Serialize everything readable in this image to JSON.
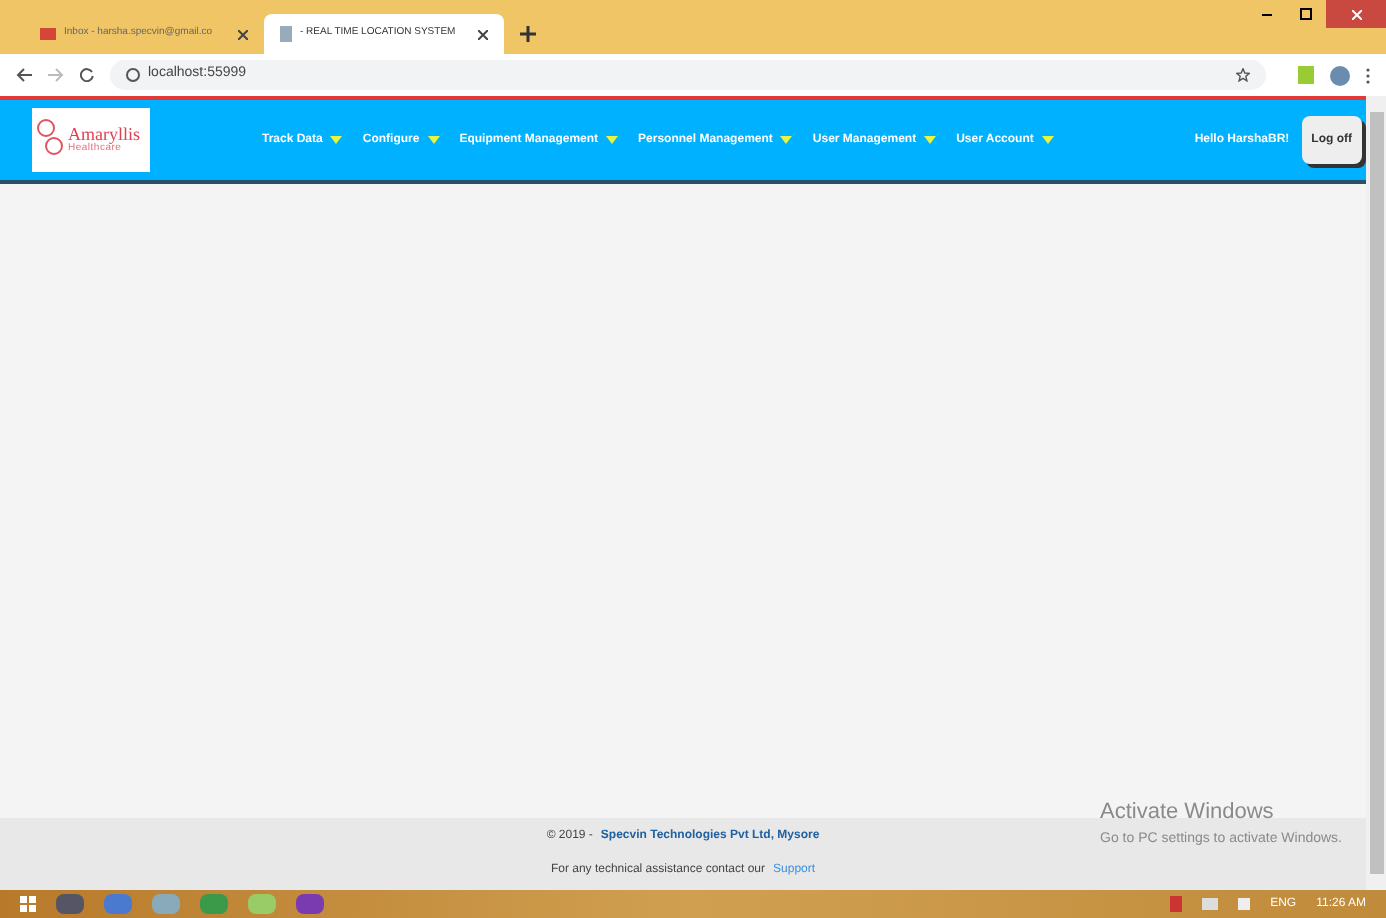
{
  "browser": {
    "tabs": [
      {
        "title": "Inbox - harsha.specvin@gmail.co",
        "selected": false
      },
      {
        "title": "- REAL TIME LOCATION SYSTEM",
        "selected": true
      }
    ],
    "address": "localhost:55999"
  },
  "header": {
    "logo_name": "Amaryllis",
    "logo_sub": "Healthcare",
    "menu": [
      "Track Data",
      "Configure",
      "Equipment Management",
      "Personnel Management",
      "User Management",
      "User Account"
    ],
    "greeting": "Hello HarshaBR!",
    "logoff": "Log off"
  },
  "footer": {
    "copyright": "© 2019 -",
    "company": "Specvin Technologies Pvt Ltd, Mysore",
    "assist": "For any technical assistance contact our",
    "support": "Support"
  },
  "activation": {
    "title": "Activate Windows",
    "text": "Go to PC settings to activate Windows."
  },
  "taskbar": {
    "language": "ENG",
    "time": "11:26 AM"
  }
}
